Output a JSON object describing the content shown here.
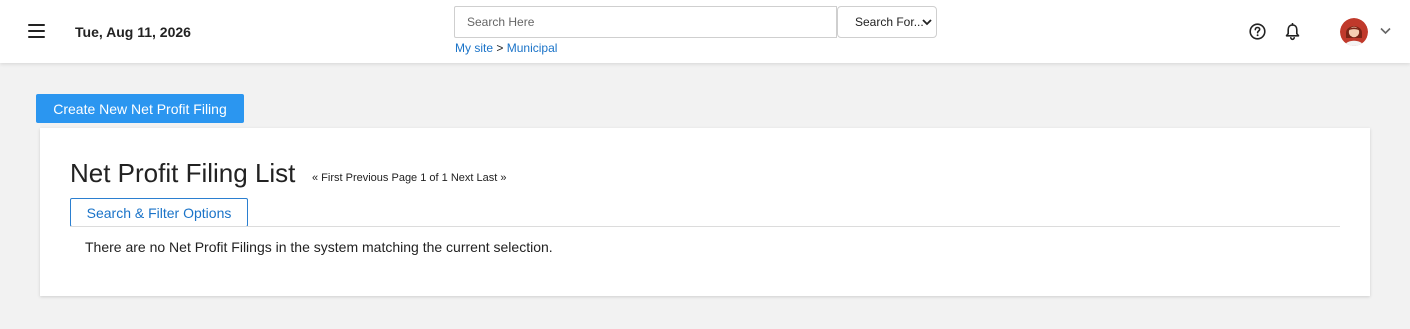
{
  "header": {
    "date": "Tue, Aug 11, 2026",
    "search": {
      "placeholder": "Search Here",
      "value": ""
    },
    "search_scope": {
      "selected": "Search For..."
    },
    "breadcrumb": {
      "items": [
        "My site",
        "Municipal"
      ],
      "separator": ">"
    },
    "icons": {
      "menu": "hamburger-menu-icon",
      "help": "help-circle-icon",
      "notifications": "bell-icon",
      "user_menu": "chevron-down-icon"
    }
  },
  "main": {
    "create_button_label": "Create New Net Profit Filing",
    "card": {
      "title": "Net Profit Filing List",
      "pager": {
        "first": "« First",
        "previous": "Previous",
        "page_text": "Page 1 of 1",
        "next": "Next",
        "last": "Last »"
      },
      "filter_button_label": "Search & Filter Options",
      "empty_message": "There are no Net Profit Filings in the system matching the current selection."
    }
  },
  "colors": {
    "accent": "#2b96f0",
    "link": "#1a73c8",
    "background": "#f2f2f2",
    "card": "#ffffff"
  }
}
